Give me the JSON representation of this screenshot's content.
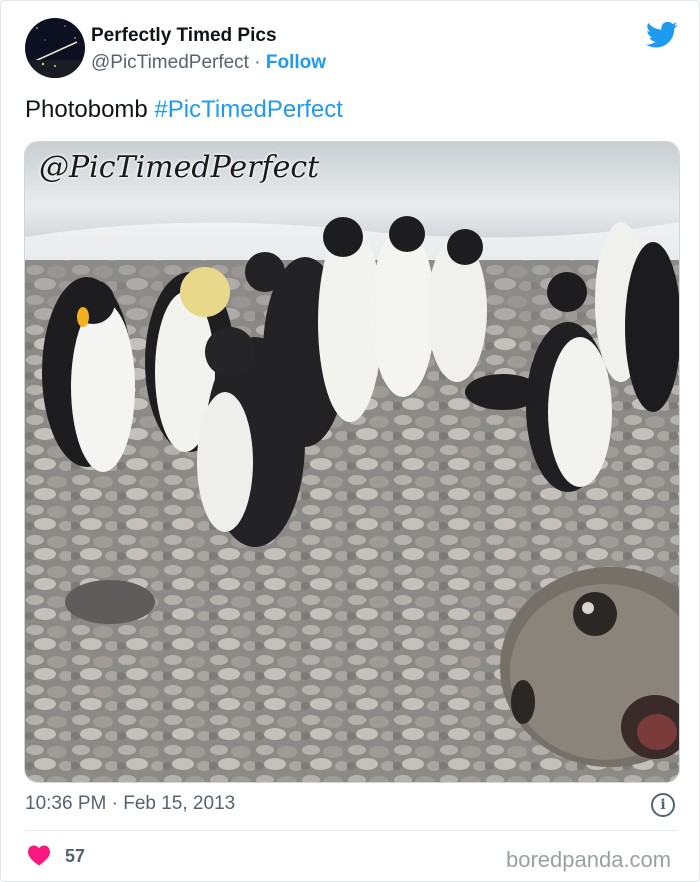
{
  "tweet": {
    "author_name": "Perfectly Timed Pics",
    "author_handle": "@PicTimedPerfect",
    "separator": " · ",
    "follow_label": "Follow",
    "text": "Photobomb ",
    "hashtag": "#PicTimedPerfect",
    "image_watermark": "@PicTimedPerfect",
    "time": "10:36 PM",
    "date_separator": " · ",
    "date": "Feb 15, 2013",
    "like_count": "57",
    "info_symbol": "i"
  },
  "icons": {
    "brand": "twitter-bird-icon",
    "like": "heart-icon",
    "info": "info-icon"
  },
  "footer": {
    "credit": "boredpanda.com"
  },
  "colors": {
    "accent": "#1d9bf0",
    "heart": "#f91880",
    "text_secondary": "#536471"
  }
}
